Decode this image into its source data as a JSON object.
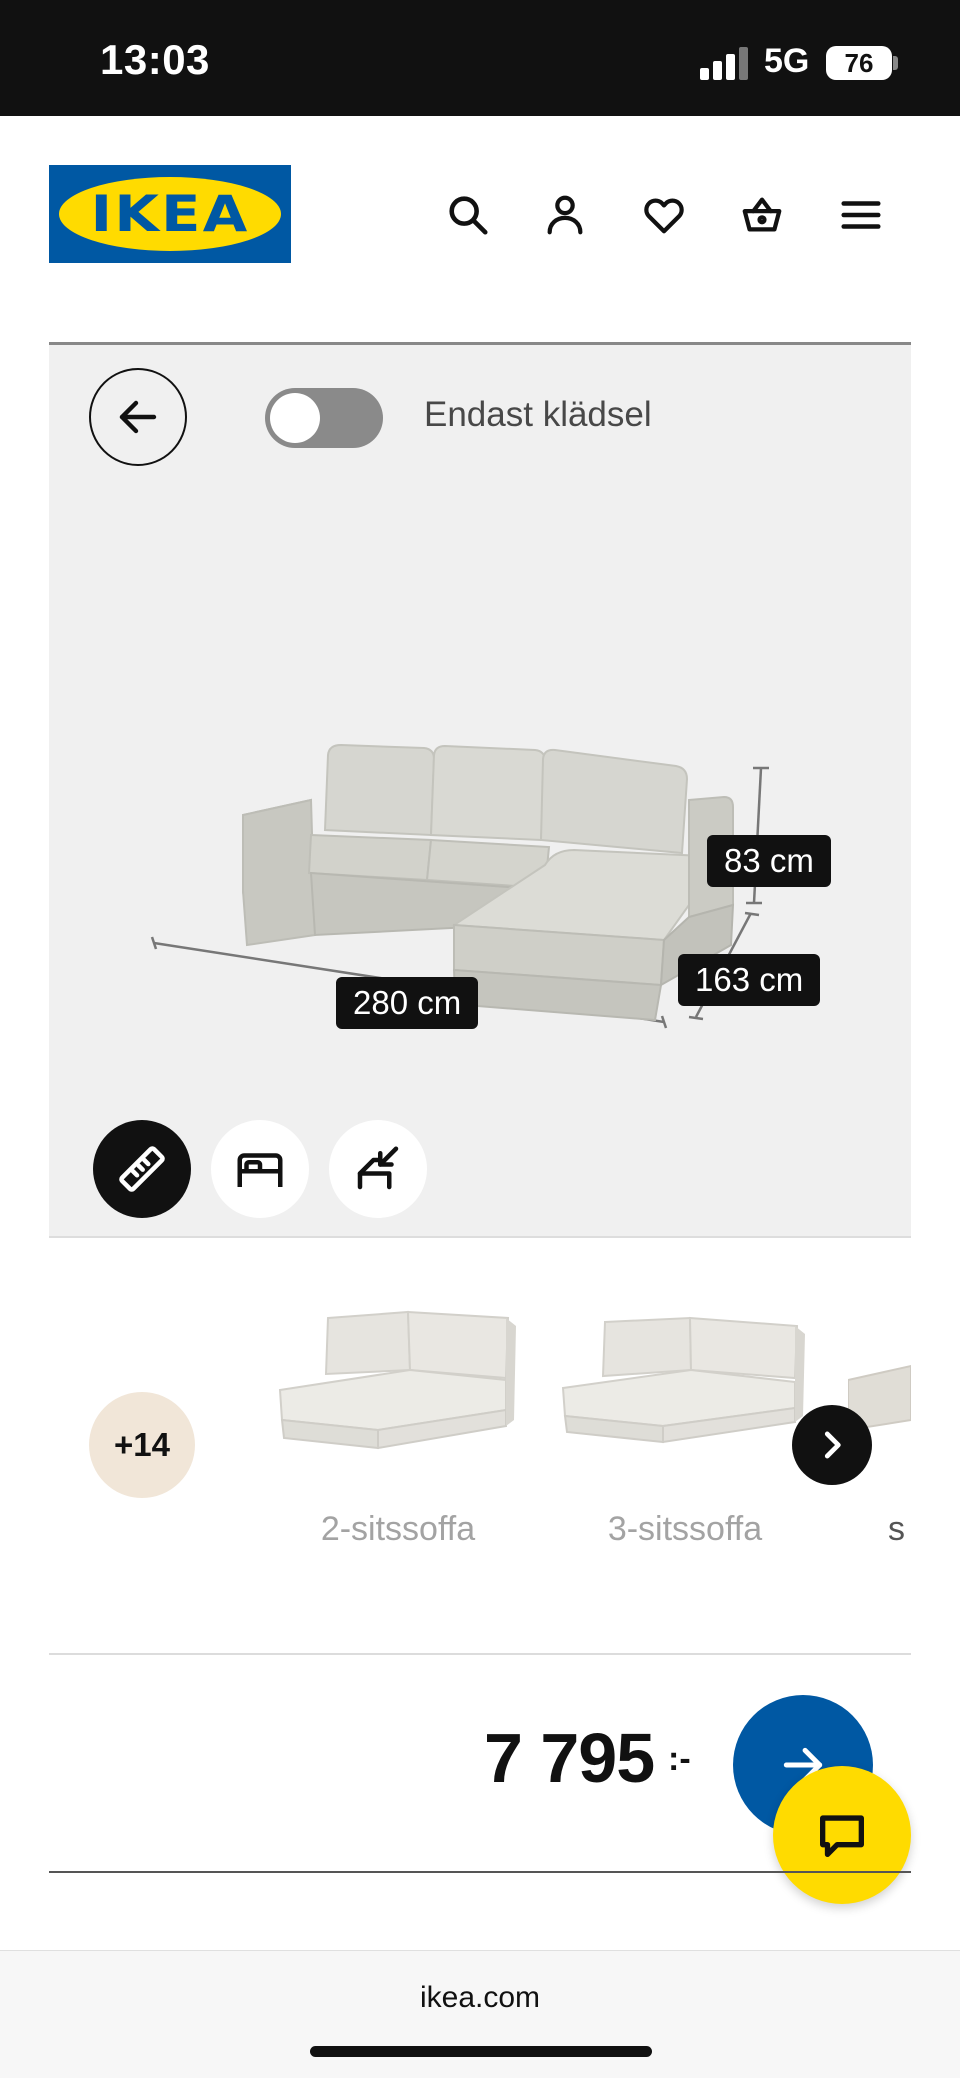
{
  "status_bar": {
    "time": "13:03",
    "network": "5G",
    "battery": "76"
  },
  "header": {
    "logo_text": "IKEA",
    "icons": [
      "search-icon",
      "profile-icon",
      "heart-icon",
      "basket-icon",
      "menu-icon"
    ]
  },
  "viewer": {
    "upholstery_toggle_label": "Endast klädsel",
    "upholstery_only": false,
    "dimensions": {
      "height": "83 cm",
      "depth": "163 cm",
      "width": "280 cm"
    },
    "tools": [
      "measure-icon",
      "bed-icon",
      "resize-icon"
    ]
  },
  "variants": {
    "more_count": "+14",
    "items": [
      {
        "label": "2-sitssoffa"
      },
      {
        "label": "3-sitssoffa"
      },
      {
        "label": "s"
      }
    ]
  },
  "price": {
    "amount": "7 795",
    "suffix": ":-"
  },
  "browser": {
    "url": "ikea.com"
  },
  "colors": {
    "ikea_blue": "#0058a3",
    "ikea_yellow": "#ffdb00",
    "viewer_bg": "#f0f0f0"
  }
}
